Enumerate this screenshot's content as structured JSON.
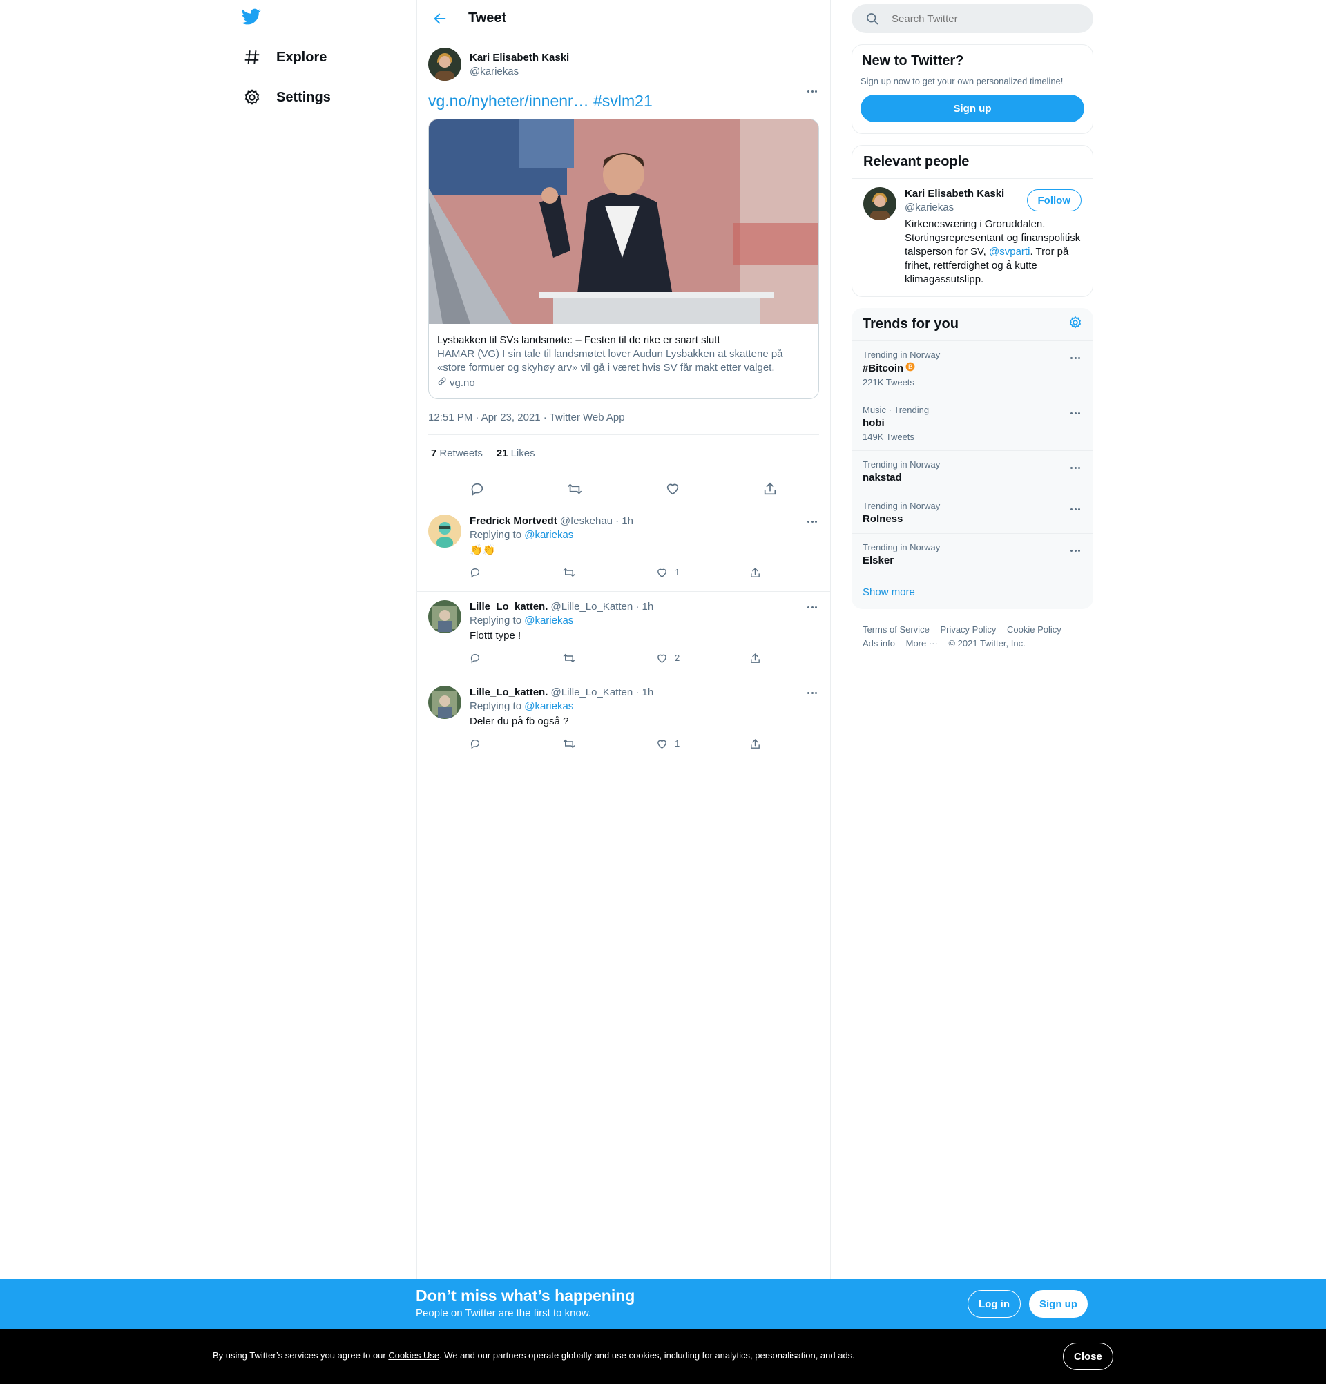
{
  "nav": {
    "explore": "Explore",
    "settings": "Settings"
  },
  "header": {
    "title": "Tweet"
  },
  "tweet": {
    "author_name": "Kari Elisabeth Kaski",
    "author_handle": "@kariekas",
    "text_link": "vg.no/nyheter/innenr…",
    "text_hashtag": "#svlm21",
    "card_title": "Lysbakken til SVs landsmøte: – Festen til de rike er snart slutt",
    "card_desc": "HAMAR (VG) I sin tale til landsmøtet lover Audun Lysbakken at skattene på «store formuer og skyhøy arv» vil gå i været hvis SV får makt etter valget.",
    "card_domain": "vg.no",
    "timestamp": "12:51 PM · Apr 23, 2021 · Twitter Web App",
    "retweets_count": "7",
    "retweets_label": "Retweets",
    "likes_count": "21",
    "likes_label": "Likes"
  },
  "replies": [
    {
      "name": "Fredrick Mortvedt",
      "meta": "@feskehau · 1h",
      "replying_prefix": "Replying to",
      "replying_to": "@kariekas",
      "text": "👏👏",
      "likes": "1"
    },
    {
      "name": "Lille_Lo_katten.",
      "meta": "@Lille_Lo_Katten · 1h",
      "replying_prefix": "Replying to",
      "replying_to": "@kariekas",
      "text": "Flottt type !",
      "likes": "2"
    },
    {
      "name": "Lille_Lo_katten.",
      "meta": "@Lille_Lo_Katten · 1h",
      "replying_prefix": "Replying to",
      "replying_to": "@kariekas",
      "text": "Deler du på fb også ?",
      "likes": "1"
    }
  ],
  "search": {
    "placeholder": "Search Twitter"
  },
  "new_to_twitter": {
    "title": "New to Twitter?",
    "subtitle": "Sign up now to get your own personalized timeline!",
    "signup": "Sign up"
  },
  "relevant": {
    "title": "Relevant people",
    "name": "Kari Elisabeth Kaski",
    "handle": "@kariekas",
    "follow": "Follow",
    "bio_1": "Kirkenesværing i Groruddalen. Stortingsrepresentant og finanspolitisk talsperson for SV, ",
    "bio_link": "@svparti",
    "bio_2": ". Tror på frihet, rettferdighet og å kutte klimagassutslipp."
  },
  "trends": {
    "title": "Trends for you",
    "items": [
      {
        "context": "Trending in Norway",
        "name": "#Bitcoin",
        "count": "221K Tweets"
      },
      {
        "context": "Music · Trending",
        "name": "hobi",
        "count": "149K Tweets"
      },
      {
        "context": "Trending in Norway",
        "name": "nakstad",
        "count": ""
      },
      {
        "context": "Trending in Norway",
        "name": "Rolness",
        "count": ""
      },
      {
        "context": "Trending in Norway",
        "name": "Elsker",
        "count": ""
      }
    ],
    "show_more": "Show more"
  },
  "footer": {
    "terms": "Terms of Service",
    "privacy": "Privacy Policy",
    "cookie": "Cookie Policy",
    "ads": "Ads info",
    "more": "More ···",
    "copyright": "© 2021 Twitter, Inc."
  },
  "bottombar": {
    "title": "Don’t miss what’s happening",
    "subtitle": "People on Twitter are the first to know.",
    "login": "Log in",
    "signup": "Sign up"
  },
  "cookies": {
    "text_1": "By using Twitter’s services you agree to our ",
    "link": "Cookies Use",
    "text_2": ". We and our partners operate globally and use cookies, including for analytics, personalisation, and ads.",
    "close": "Close"
  },
  "colors": {
    "accent": "#1da1f2",
    "link": "#1b95e0",
    "muted": "#5b7083",
    "bitcoin": "#f7931a"
  }
}
